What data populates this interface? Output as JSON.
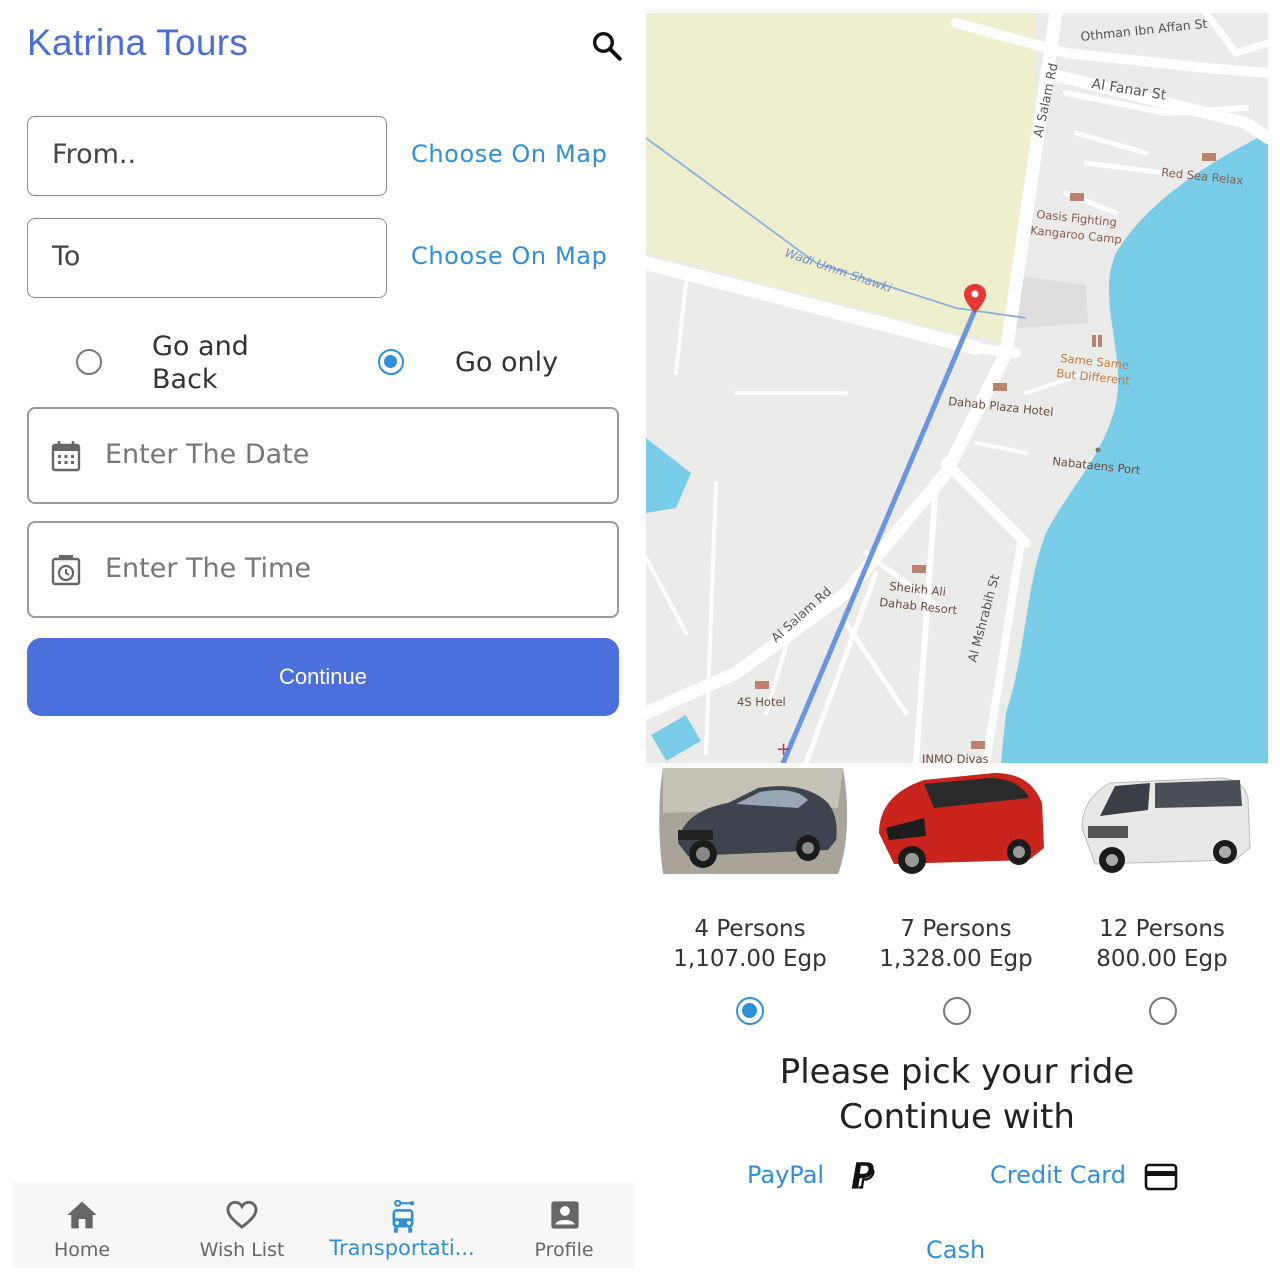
{
  "left": {
    "app_title": "Katrina Tours",
    "from_field": {
      "value": "From.."
    },
    "to_field": {
      "value": "To"
    },
    "choose_on_map": "Choose On Map",
    "trip_options": [
      {
        "label_line1": "Go and",
        "label_line2": "Back",
        "selected": false
      },
      {
        "label": "Go only",
        "selected": true
      }
    ],
    "date_field": {
      "placeholder": "Enter The Date"
    },
    "time_field": {
      "placeholder": "Enter The Time"
    },
    "continue_label": "Continue",
    "bottom_nav": [
      {
        "label": "Home",
        "icon": "home-icon",
        "active": false
      },
      {
        "label": "Wish List",
        "icon": "heart-icon",
        "active": false
      },
      {
        "label": "Transportati...",
        "icon": "bus-icon",
        "active": true
      },
      {
        "label": "Profile",
        "icon": "person-icon",
        "active": false
      }
    ]
  },
  "map": {
    "labels": {
      "othman": "Othman Ibn Affan St",
      "alfanar": "Al Fanar St",
      "alsalam_top": "Al Salam Rd",
      "redsea": "Red Sea Relax",
      "oasis1": "Oasis Fighting",
      "oasis2": "Kangaroo Camp",
      "wadi": "Wadi Umm Shawki",
      "samesame1": "Same Same",
      "samesame2": "But Different",
      "dahab": "Dahab Plaza Hotel",
      "nabataens": "Nabataens Port",
      "sheikh1": "Sheikh Ali",
      "sheikh2": "Dahab Resort",
      "mshrabih": "Al Mshrabih St",
      "alsalam_bottom": "Al Salam Rd",
      "hotel4s": "4S Hotel",
      "inmo": "INMO Divas"
    }
  },
  "vehicles": [
    {
      "persons": "4 Persons",
      "price": "1,107.00 Egp",
      "selected": true,
      "color": "#3d4450"
    },
    {
      "persons": "7 Persons",
      "price": "1,328.00 Egp",
      "selected": false,
      "color": "#c8231c"
    },
    {
      "persons": "12 Persons",
      "price": "800.00 Egp",
      "selected": false,
      "color": "#e8e8e8"
    }
  ],
  "pick_line1": "Please pick your ride",
  "pick_line2": "Continue with",
  "payment": {
    "paypal": "PayPal",
    "credit_card": "Credit Card",
    "cash": "Cash"
  },
  "colors": {
    "accent": "#2f8fd8",
    "button": "#4b6fdc",
    "title": "#4a6fd9",
    "sea": "#79cde9",
    "route": "#6a96e0"
  }
}
